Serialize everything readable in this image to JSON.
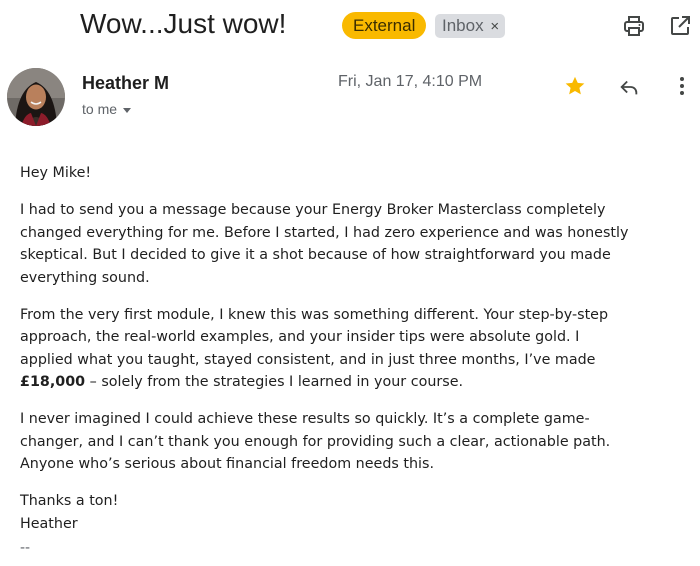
{
  "email": {
    "subject": "Wow...Just wow!",
    "labels": {
      "external": "External",
      "inbox": "Inbox",
      "inbox_remove": "×"
    },
    "sender": {
      "name": "Heather M",
      "recipient": "to me"
    },
    "date": "Fri, Jan 17, 4:10 PM",
    "starred": true,
    "body": {
      "greeting": "Hey Mike!",
      "p1": [
        "I had to send you a message because your Energy Broker Masterclass completely",
        "changed everything for me. Before I started, I had zero experience and was honestly",
        "skeptical. But I decided to give it a shot because of how straightforward you made",
        "everything sound."
      ],
      "p2": [
        "From the very first module, I knew this was something different. Your step-by-step",
        "approach, the real-world examples, and your insider tips were absolute gold. I",
        "applied what you taught, stayed consistent, and in just three months, I’ve made"
      ],
      "p2_amount": "£18,000",
      "p2_rest": " – solely from the strategies I learned in your course.",
      "p3": [
        "I never imagined I could achieve these results so quickly. It’s a complete game-",
        "changer, and I can’t thank you enough for providing such a clear, actionable path.",
        "Anyone who’s serious about financial freedom needs this."
      ],
      "closing": "Thanks a ton!",
      "signoff": "Heather",
      "signature_sep": "--"
    }
  },
  "colors": {
    "external": "#f9b900",
    "star": "#f9b900",
    "inbox": "#dadce0"
  },
  "icons": [
    "print-icon",
    "open-in-new-window-icon",
    "star-icon",
    "reply-icon",
    "more-vert-icon"
  ]
}
